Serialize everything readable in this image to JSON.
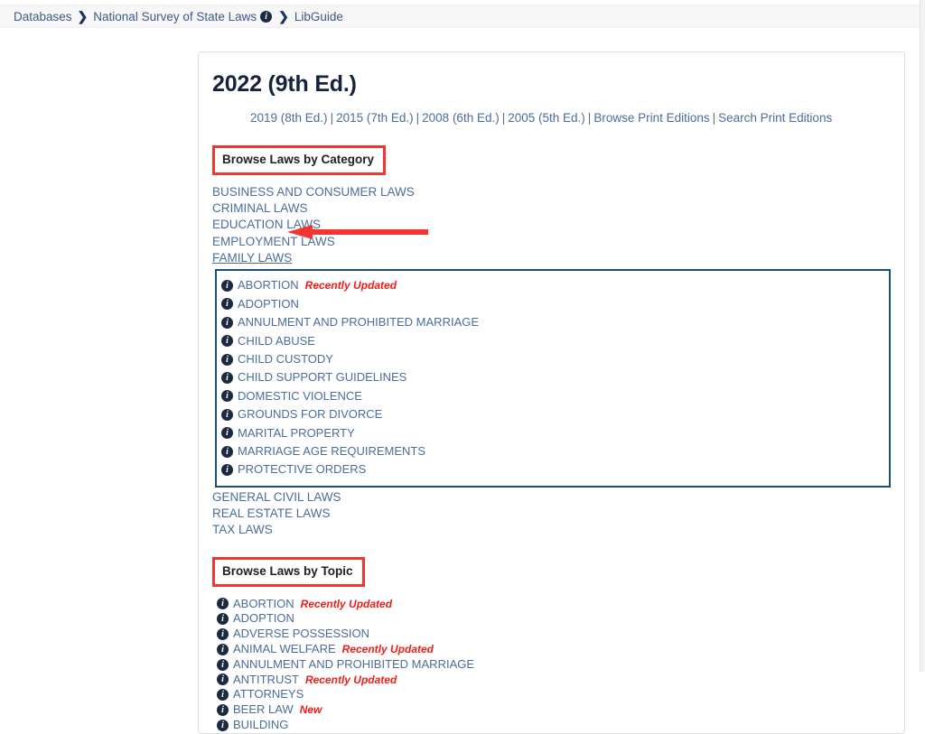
{
  "breadcrumb": {
    "items": [
      {
        "label": "Databases",
        "icon": null
      },
      {
        "label": "National Survey of State Laws",
        "icon": "info-icon"
      },
      {
        "label": "LibGuide",
        "icon": null
      }
    ],
    "separator": "❯"
  },
  "card": {
    "title": "2022 (9th Ed.)",
    "editions": [
      "2019 (8th Ed.)",
      "2015 (7th Ed.)",
      "2008 (6th Ed.)",
      "2005 (5th Ed.)",
      "Browse Print Editions",
      "Search Print Editions"
    ],
    "edition_separator": "|"
  },
  "category_section": {
    "heading": "Browse Laws by Category",
    "annotation_color": "#f5332f",
    "items": [
      {
        "label": "BUSINESS AND CONSUMER LAWS",
        "active": false
      },
      {
        "label": "CRIMINAL LAWS",
        "active": false
      },
      {
        "label": "EDUCATION LAWS",
        "active": false
      },
      {
        "label": "EMPLOYMENT LAWS",
        "active": false
      },
      {
        "label": "FAMILY LAWS",
        "active": true
      }
    ],
    "items_after": [
      {
        "label": "GENERAL CIVIL LAWS"
      },
      {
        "label": "REAL ESTATE LAWS"
      },
      {
        "label": "TAX LAWS"
      }
    ],
    "expanded": {
      "border_color": "#1d4e78",
      "items": [
        {
          "label": "ABORTION",
          "badge": "Recently Updated"
        },
        {
          "label": "ADOPTION",
          "badge": ""
        },
        {
          "label": "ANNULMENT AND PROHIBITED MARRIAGE",
          "badge": ""
        },
        {
          "label": "CHILD ABUSE",
          "badge": ""
        },
        {
          "label": "CHILD CUSTODY",
          "badge": ""
        },
        {
          "label": "CHILD SUPPORT GUIDELINES",
          "badge": ""
        },
        {
          "label": "DOMESTIC VIOLENCE",
          "badge": ""
        },
        {
          "label": "GROUNDS FOR DIVORCE",
          "badge": ""
        },
        {
          "label": "MARITAL PROPERTY",
          "badge": ""
        },
        {
          "label": "MARRIAGE AGE REQUIREMENTS",
          "badge": ""
        },
        {
          "label": "PROTECTIVE ORDERS",
          "badge": ""
        }
      ]
    }
  },
  "topic_section": {
    "heading": "Browse Laws by Topic",
    "annotation_color": "#f5332f",
    "items": [
      {
        "label": "ABORTION",
        "badge": "Recently Updated"
      },
      {
        "label": "ADOPTION",
        "badge": ""
      },
      {
        "label": "ADVERSE POSSESSION",
        "badge": ""
      },
      {
        "label": "ANIMAL WELFARE",
        "badge": "Recently Updated"
      },
      {
        "label": "ANNULMENT AND PROHIBITED MARRIAGE",
        "badge": ""
      },
      {
        "label": "ANTITRUST",
        "badge": "Recently Updated"
      },
      {
        "label": "ATTORNEYS",
        "badge": ""
      },
      {
        "label": "BEER LAW",
        "badge": "New"
      },
      {
        "label": "BUILDING",
        "badge": ""
      }
    ]
  },
  "annotations": {
    "arrow": {
      "name": "pointer-arrow",
      "color": "#f5332f",
      "direction": "left",
      "target": "FAMILY LAWS"
    }
  }
}
